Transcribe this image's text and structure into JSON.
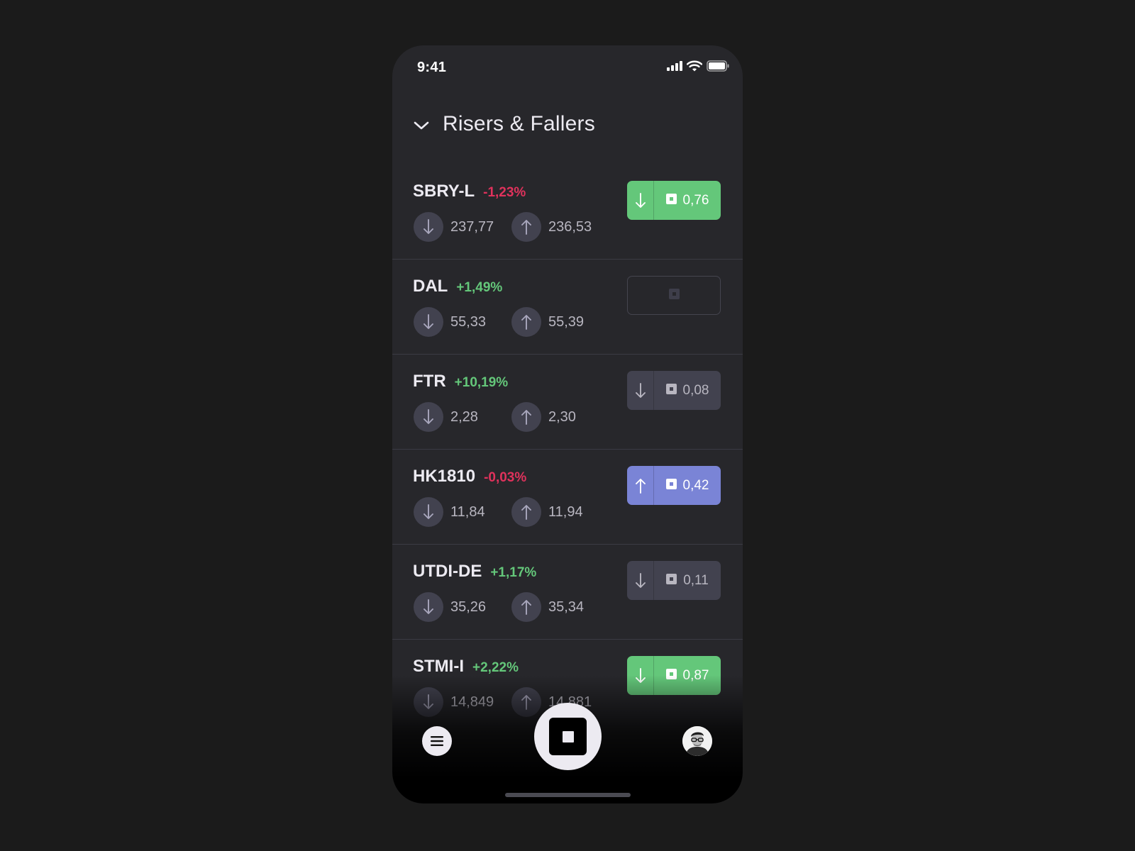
{
  "status_bar": {
    "time": "9:41"
  },
  "header": {
    "title": "Risers & Fallers"
  },
  "colors": {
    "negative": "#e0325c",
    "positive": "#64c77a",
    "button_green": "#64c77a",
    "button_blue": "#7a84d6",
    "button_gray": "#42424f"
  },
  "instruments": [
    {
      "symbol": "SBRY-L",
      "change": "-1,23%",
      "trend": "neg",
      "sell": "237,77",
      "buy": "236,53",
      "position": {
        "style": "green",
        "direction": "down",
        "value": "0,76"
      }
    },
    {
      "symbol": "DAL",
      "change": "+1,49%",
      "trend": "pos",
      "sell": "55,33",
      "buy": "55,39",
      "position": {
        "style": "empty",
        "direction": "",
        "value": ""
      }
    },
    {
      "symbol": "FTR",
      "change": "+10,19%",
      "trend": "pos",
      "sell": "2,28",
      "buy": "2,30",
      "position": {
        "style": "gray",
        "direction": "down",
        "value": "0,08"
      }
    },
    {
      "symbol": "HK1810",
      "change": "-0,03%",
      "trend": "neg",
      "sell": "11,84",
      "buy": "11,94",
      "position": {
        "style": "blue",
        "direction": "up",
        "value": "0,42"
      }
    },
    {
      "symbol": "UTDI-DE",
      "change": "+1,17%",
      "trend": "pos",
      "sell": "35,26",
      "buy": "35,34",
      "position": {
        "style": "gray",
        "direction": "down",
        "value": "0,11"
      }
    },
    {
      "symbol": "STMI-I",
      "change": "+2,22%",
      "trend": "pos",
      "sell": "14,849",
      "buy": "14,881",
      "position": {
        "style": "green",
        "direction": "down",
        "value": "0,87"
      }
    }
  ],
  "tab_bar": {
    "left_icon": "menu-icon",
    "center_icon": "stop-square-icon",
    "right_icon": "profile-avatar"
  }
}
